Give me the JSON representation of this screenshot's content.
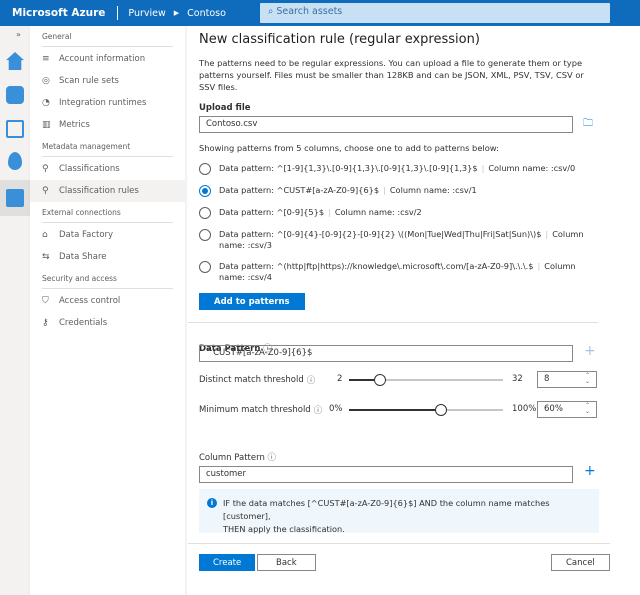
{
  "header": {
    "brand": "Microsoft Azure",
    "crumbs": [
      "Purview",
      "Contoso"
    ],
    "search_placeholder": "Search assets"
  },
  "sidebar": {
    "sections": [
      {
        "title": "General",
        "items": [
          {
            "label": "Account information",
            "icon": "list-icon"
          },
          {
            "label": "Scan rule sets",
            "icon": "scan-icon"
          },
          {
            "label": "Integration runtimes",
            "icon": "runtime-icon"
          },
          {
            "label": "Metrics",
            "icon": "metrics-icon"
          }
        ]
      },
      {
        "title": "Metadata management",
        "items": [
          {
            "label": "Classifications",
            "icon": "classification-icon"
          },
          {
            "label": "Classification rules",
            "icon": "classification-rule-icon",
            "selected": true
          }
        ]
      },
      {
        "title": "External connections",
        "items": [
          {
            "label": "Data Factory",
            "icon": "factory-icon"
          },
          {
            "label": "Data Share",
            "icon": "share-icon"
          }
        ]
      },
      {
        "title": "Security and access",
        "items": [
          {
            "label": "Access control",
            "icon": "access-icon"
          },
          {
            "label": "Credentials",
            "icon": "credentials-icon"
          }
        ]
      }
    ]
  },
  "panel": {
    "title": "New classification rule (regular expression)",
    "description": "The patterns need to be regular expressions. You can upload a file to generate them or type patterns yourself. Files must be smaller than 128KB and can be JSON, XML, PSV, TSV, CSV or SSV files.",
    "upload_label": "Upload file",
    "upload_value": "Contoso.csv",
    "patterns_intro": "Showing patterns from 5 columns, choose one to add to patterns below:",
    "patterns": [
      {
        "pattern": "Data pattern: ^[1-9]{1,3}\\.[0-9]{1,3}\\.[0-9]{1,3}\\.[0-9]{1,3}$",
        "column": "Column name: :csv/0",
        "selected": false
      },
      {
        "pattern": "Data pattern: ^CUST#[a-zA-Z0-9]{6}$",
        "column": "Column name: :csv/1",
        "selected": true
      },
      {
        "pattern": "Data pattern: ^[0-9]{5}$",
        "column": "Column name: :csv/2",
        "selected": false
      },
      {
        "pattern": "Data pattern: ^[0-9]{4}-[0-9]{2}-[0-9]{2} \\((Mon|Tue|Wed|Thu|Fri|Sat|Sun)\\)$",
        "column": "Column name: :csv/3",
        "selected": false
      },
      {
        "pattern": "Data pattern: ^(http|ftp|https)://knowledge\\.microsoft\\.com/[a-zA-Z0-9]\\.\\.\\.$",
        "column": "Column name: :csv/4",
        "selected": false
      }
    ],
    "add_button": "Add to patterns",
    "data_pattern_label": "Data Pattern",
    "data_pattern_value": "^CUST#[a-zA-Z0-9]{6}$",
    "distinct": {
      "label": "Distinct match threshold",
      "min": "2",
      "max": "32",
      "value": "8",
      "num": 8,
      "lo": 2,
      "hi": 32
    },
    "minimum": {
      "label": "Minimum match threshold",
      "min": "0%",
      "max": "100%",
      "value": "60%",
      "num": 60,
      "lo": 0,
      "hi": 100
    },
    "column_pattern_label": "Column Pattern",
    "column_pattern_value": "customer",
    "info_line1": "IF the data matches [^CUST#[a-zA-Z0-9]{6}$] AND the column name matches [customer],",
    "info_line2": "THEN apply the classification.",
    "create": "Create",
    "back": "Back",
    "cancel": "Cancel"
  }
}
